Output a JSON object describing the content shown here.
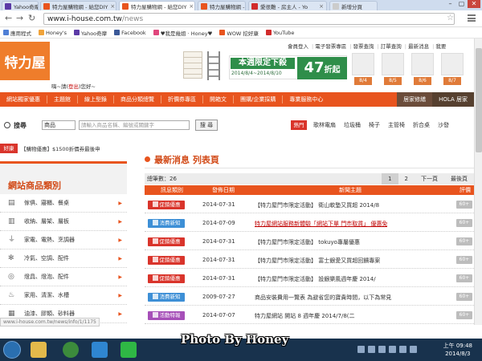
{
  "browser": {
    "tabs": [
      {
        "label": "Yahoo奇摩",
        "color": "#5b3aa6"
      },
      {
        "label": "特力屋購物網 - 給您DIY",
        "color": "#e8541e"
      },
      {
        "label": "特力屋購物網 - 給您DIY",
        "color": "#e8541e"
      },
      {
        "label": "特力屋購物網 - 給您DIY",
        "color": "#e8541e"
      },
      {
        "label": "愛很難 - 房主人 - Yo",
        "color": "#d12b2b"
      },
      {
        "label": "新增分頁",
        "color": "#cccccc"
      }
    ],
    "window_controls": {
      "min": "–",
      "max": "▢",
      "close": "✕"
    },
    "url_host": "www.i-house.com.tw",
    "url_path": "/news",
    "back": "←",
    "forward": "→",
    "reload": "↻"
  },
  "bookmarks": [
    {
      "label": "應用程式",
      "color": "#4f7fd6"
    },
    {
      "label": "Honey's",
      "color": "#f0a33a"
    },
    {
      "label": "Yahoo奇摩",
      "color": "#5b3aa6"
    },
    {
      "label": "Facebook",
      "color": "#3b5998"
    },
    {
      "label": "♥我是幾姐 · Honey♥",
      "color": "#e0467c"
    },
    {
      "label": "WOW 挖好康",
      "color": "#e8541e"
    },
    {
      "label": "YouTube",
      "color": "#d12b2b"
    }
  ],
  "site": {
    "logo": "特力屋",
    "greeting_prefix": "嗨~請",
    "login": "登出",
    "greeting_suffix": "您好~",
    "top_links": [
      "會員登入",
      "電子發票專區",
      "發票查詢",
      "訂單查詢",
      "最新消息",
      "我要"
    ],
    "promo": {
      "title": "本週限定下殺",
      "dates": "2014/8/4~2014/8/10",
      "discount": "47",
      "discount_unit": "折起"
    },
    "deal_tags": [
      "8/4",
      "8/5",
      "8/6",
      "8/7"
    ],
    "nav": [
      "網站獨家優惠",
      "主題館",
      "線上型錄",
      "商品分類總覽",
      "折價券專區",
      "開箱文",
      "團購/企業採購",
      "專業服務中心"
    ],
    "nav_right": [
      "居家修繕",
      "HOLA 居家"
    ],
    "search": {
      "label": "搜尋",
      "scope": "商品",
      "placeholder": "請輸入商品名稱、編號或關鍵字",
      "button": "搜 尋"
    },
    "hot_label": "熱門",
    "hot_links": [
      "歌林電扇",
      "垃圾桶",
      "椅子",
      "主管椅",
      "折合桌",
      "沙發"
    ],
    "coupon_tag": "好康",
    "coupon_text": "【購物優惠】$1500折價券最後申",
    "sidebar_title": "網站商品類別",
    "categories": [
      {
        "icon": "▤",
        "label": "傢俱、寢櫃、餐桌"
      },
      {
        "icon": "▥",
        "label": "收納、層架、層板"
      },
      {
        "icon": "⏚",
        "label": "家電、電熱、烹調器"
      },
      {
        "icon": "✻",
        "label": "冷氣、空調、配件"
      },
      {
        "icon": "◎",
        "label": "燈具、燈泡、配件"
      },
      {
        "icon": "♨",
        "label": "家用、清潔、水槽"
      },
      {
        "icon": "▦",
        "label": "油漆、膠類、砂料器"
      }
    ],
    "news_title": "最新消息 列表頁",
    "total_label": "總筆數：26",
    "pages": [
      "1",
      "2",
      "下一頁",
      "最後頁"
    ],
    "table_headers": [
      "訊息類別",
      "發佈日期",
      "新聞主題",
      "評價"
    ],
    "news": [
      {
        "badge": "促銷優惠",
        "color": "#d9342b",
        "date": "2014-07-31",
        "title": "【特力屋門市限定活動】 衛山軟墊又買超 2014/8",
        "red": false,
        "score": "60+"
      },
      {
        "badge": "消費新知",
        "color": "#3d8fd6",
        "date": "2014-07-09",
        "title": "特力屋網站服務新體驗「網站下單 門市取貨」 優惠免",
        "red": true,
        "score": "60+"
      },
      {
        "badge": "促銷優惠",
        "color": "#d9342b",
        "date": "2014-07-31",
        "title": "【特力屋門市限定活動】 tokuyo專屬優惠",
        "red": false,
        "score": "60+"
      },
      {
        "badge": "促銷優惠",
        "color": "#d9342b",
        "date": "2014-07-31",
        "title": "【特力屋門市限定活動】 富士銀愛又買超回饋專案",
        "red": false,
        "score": "60+"
      },
      {
        "badge": "促銷優惠",
        "color": "#d9342b",
        "date": "2014-07-31",
        "title": "【特力屋門市限定活動】 設銀樂風週年慶 2014/",
        "red": false,
        "score": "60+"
      },
      {
        "badge": "消費新知",
        "color": "#3d8fd6",
        "date": "2009-07-27",
        "title": "商品安裝費用一覽表 為避省您的寶貴時間，以下為常見",
        "red": false,
        "score": "60+"
      },
      {
        "badge": "活動特報",
        "color": "#a64fb8",
        "date": "2014-07-07",
        "title": "特力屋網站 開站 8 週年慶 2014/7/8(二",
        "red": false,
        "score": "60+"
      }
    ]
  },
  "status_url": "www.i-house.com.tw/news/info/1/1175",
  "taskbar": {
    "apps": [
      {
        "name": "folder",
        "color": "#e3b94b"
      },
      {
        "name": "chrome",
        "color": "#3c8b3c"
      },
      {
        "name": "ie",
        "color": "#2f86d1"
      },
      {
        "name": "line",
        "color": "#2fb845"
      }
    ],
    "time": "上午 09:48",
    "date": "2014/8/3"
  },
  "watermark": "Photo By Honey"
}
